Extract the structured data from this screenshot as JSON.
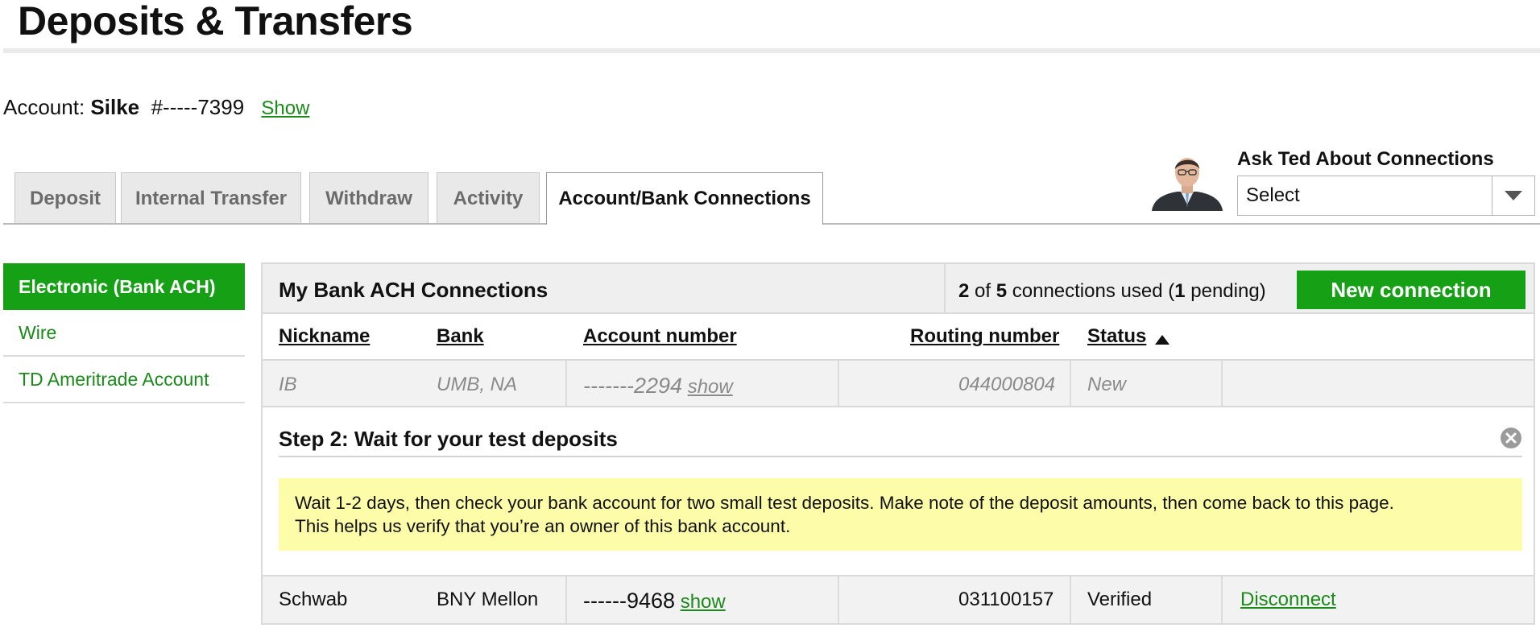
{
  "page": {
    "title": "Deposits & Transfers"
  },
  "account": {
    "label": "Account:",
    "name": "Silke",
    "number": "#-----7399",
    "show_label": "Show"
  },
  "tabs": [
    {
      "label": "Deposit"
    },
    {
      "label": "Internal Transfer"
    },
    {
      "label": "Withdraw"
    },
    {
      "label": "Activity"
    },
    {
      "label": "Account/Bank Connections",
      "active": true
    }
  ],
  "ask_ted": {
    "label": "Ask Ted About Connections",
    "selected": "Select",
    "avatar_icon": "person-avatar-icon"
  },
  "sidebar": {
    "items": [
      {
        "label": "Electronic (Bank ACH)",
        "active": true
      },
      {
        "label": "Wire"
      },
      {
        "label": "TD Ameritrade Account"
      }
    ]
  },
  "panel": {
    "title": "My Bank ACH Connections",
    "usage": {
      "used": "2",
      "of_text": "of",
      "total": "5",
      "mid_text": "connections used (",
      "pending": "1",
      "end_text": "pending)"
    },
    "new_button": "New connection",
    "columns": [
      "Nickname",
      "Bank",
      "Account number",
      "Routing number",
      "Status"
    ],
    "sort_icon": "sort-ascending-icon"
  },
  "connections": [
    {
      "nickname": "IB",
      "bank": "UMB, NA",
      "account": "-------2294",
      "show": "show",
      "routing": "044000804",
      "status": "New"
    },
    {
      "nickname": "Schwab",
      "bank": "BNY Mellon",
      "account": "------9468",
      "show": "show",
      "routing": "031100157",
      "status": "Verified",
      "action": "Disconnect"
    }
  ],
  "step": {
    "title": "Step 2: Wait for your test deposits",
    "line1": "Wait 1-2 days, then check your bank account for two small test deposits. Make note of the deposit amounts, then come back to this page.",
    "line2": "This helps us verify that you’re an owner of this bank account."
  },
  "colors": {
    "accent": "#16a016",
    "link": "#1a8a1a",
    "notice_bg": "#fdfca9"
  }
}
